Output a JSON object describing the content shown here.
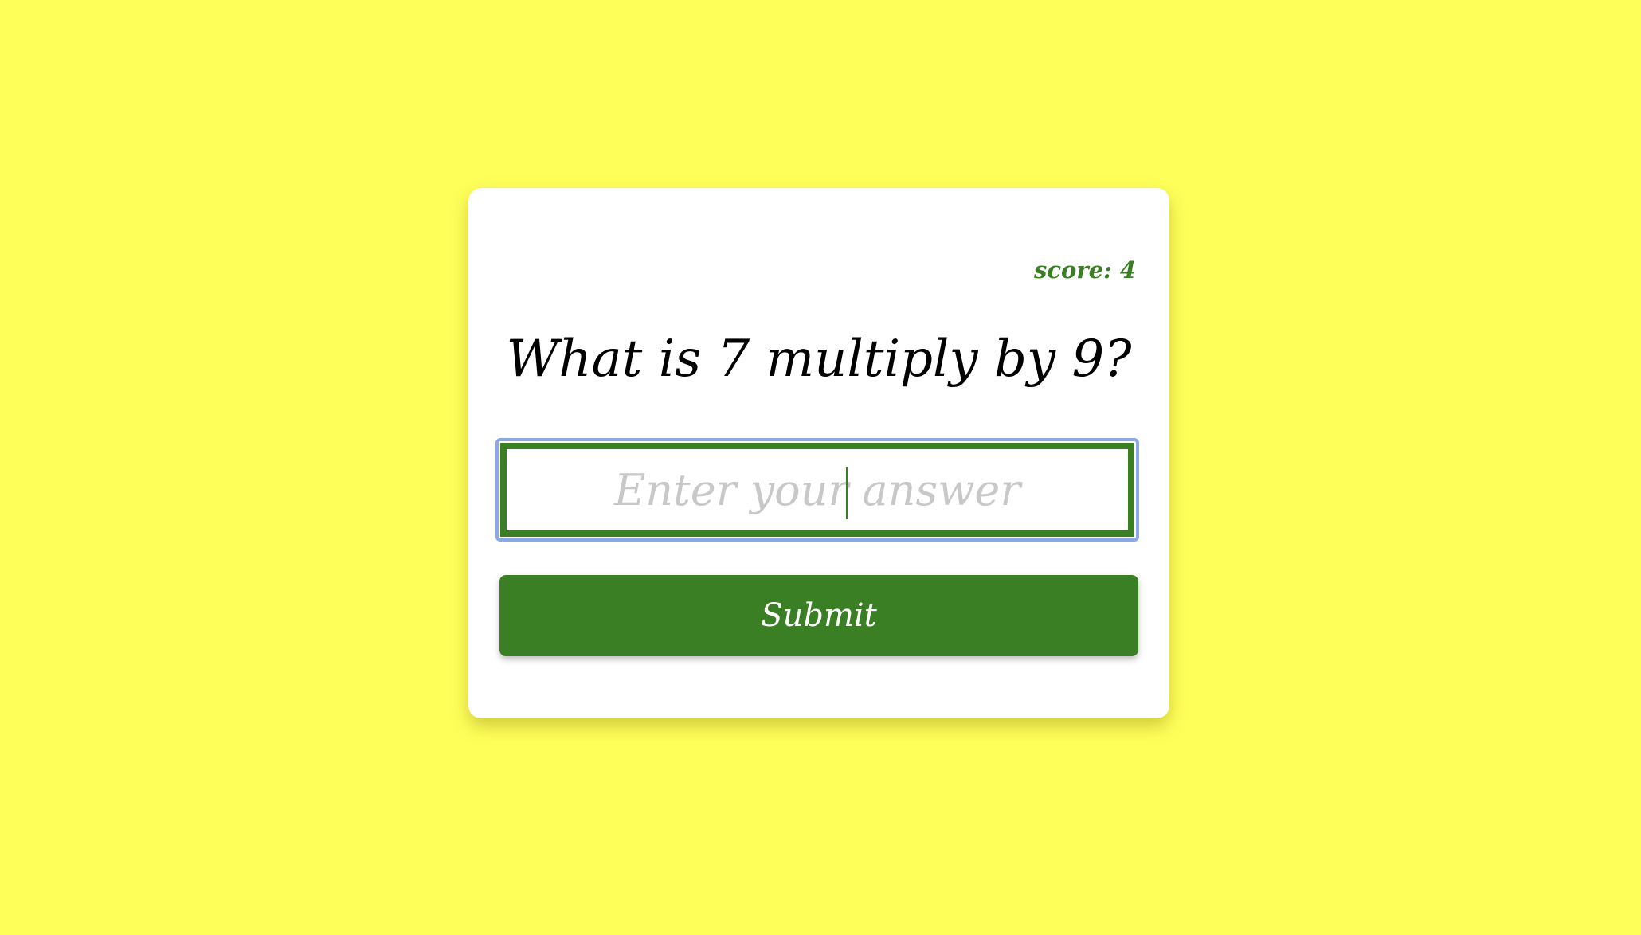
{
  "quiz": {
    "score_label": "score:",
    "score_value": "4",
    "question": "What is 7 multiply by 9?",
    "answer_value": "",
    "answer_placeholder": "Enter your answer",
    "submit_label": "Submit"
  },
  "colors": {
    "background": "#ffff5a",
    "card": "#ffffff",
    "accent_green": "#3a7f24",
    "focus_ring": "#8aa8e6",
    "placeholder": "#c8c8c8"
  }
}
